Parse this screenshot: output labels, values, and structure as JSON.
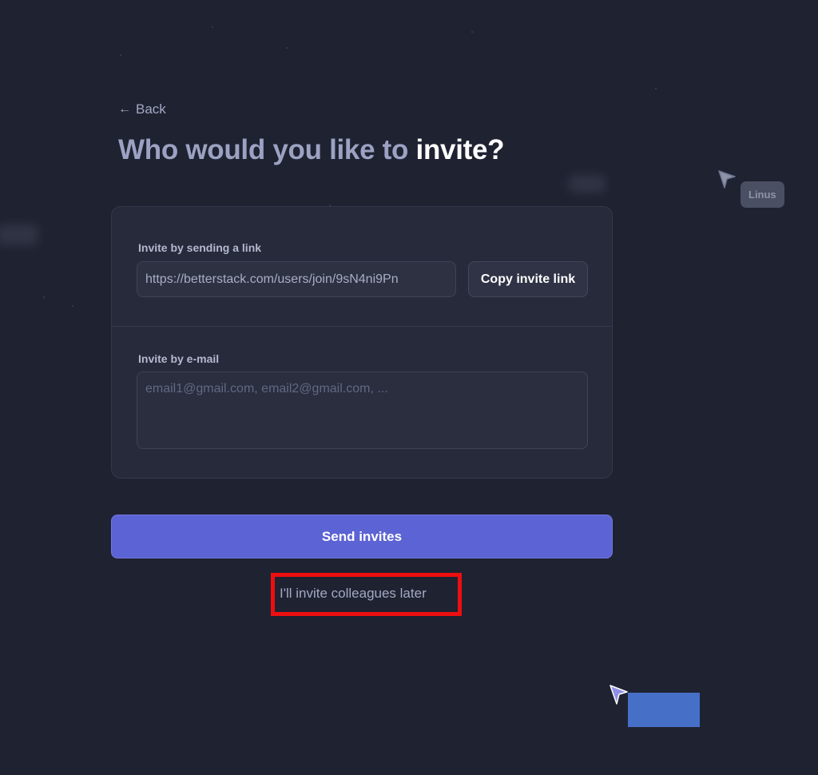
{
  "nav": {
    "back_arrow": "←",
    "back_label": "Back"
  },
  "title": {
    "prefix": "Who would you like to ",
    "accent": "invite?"
  },
  "invite_link": {
    "label": "Invite by sending a link",
    "value": "https://betterstack.com/users/join/9sN4ni9Pn",
    "copy_button": "Copy invite link"
  },
  "invite_email": {
    "label": "Invite by e-mail",
    "placeholder": "email1@gmail.com, email2@gmail.com, ..."
  },
  "actions": {
    "send_label": "Send invites",
    "later_label": "I'll invite colleagues later"
  },
  "presence": {
    "user_name": "Linus",
    "cursor_color": "#8e93a8",
    "own_cursor_color": "#8f8fe8",
    "own_badge_color": "#4670c8"
  },
  "colors": {
    "background": "#1f2231",
    "card": "#262a3a",
    "accent": "#5c63d4",
    "highlight": "#ee0e10"
  }
}
